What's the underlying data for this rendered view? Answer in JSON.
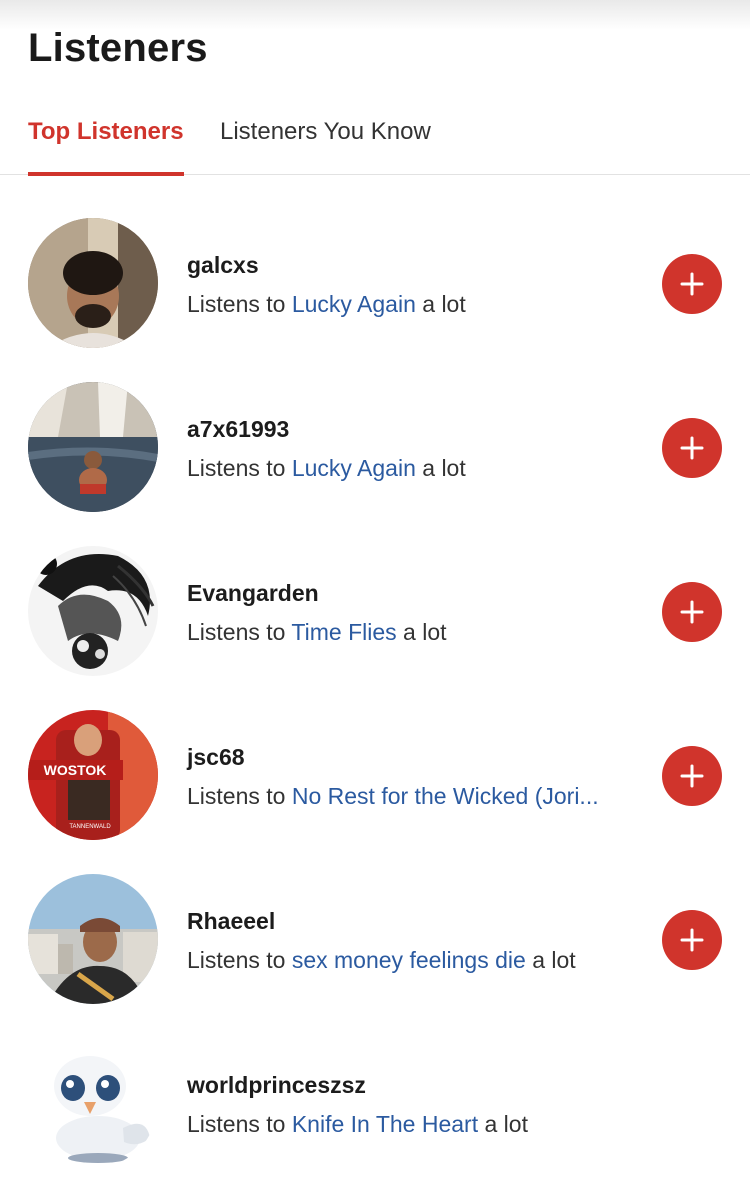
{
  "header": {
    "title": "Listeners"
  },
  "tabs": [
    {
      "label": "Top Listeners",
      "active": true
    },
    {
      "label": "Listeners You Know",
      "active": false
    }
  ],
  "listeners": [
    {
      "username": "galcxs",
      "prefix": "Listens to ",
      "song": "Lucky Again",
      "suffix": " a lot",
      "avatar": "man-with-curly-hair-photo",
      "follow": true
    },
    {
      "username": "a7x61993",
      "prefix": "Listens to ",
      "song": "Lucky Again",
      "suffix": " a lot",
      "avatar": "man-swimming-by-waterfall-photo",
      "follow": true
    },
    {
      "username": "Evangarden",
      "prefix": "Listens to ",
      "song": "Time Flies",
      "suffix": " a lot",
      "avatar": "black-and-white-artwork-photo",
      "follow": true
    },
    {
      "username": "jsc68",
      "prefix": "Listens to ",
      "song": "No Rest for the Wicked (Jori...",
      "suffix": "",
      "avatar": "wostok-bottle-photo",
      "follow": true
    },
    {
      "username": "Rhaeeel",
      "prefix": "Listens to ",
      "song": "sex money feelings die",
      "suffix": " a lot",
      "avatar": "man-in-cap-city-photo",
      "follow": true
    },
    {
      "username": "worldprinceszsz",
      "prefix": "Listens to ",
      "song": "Knife In The Heart",
      "suffix": " a lot",
      "avatar": "white-swan-toy-photo",
      "follow": false
    }
  ],
  "avatar_text": {
    "wostok": "WOSTOK",
    "tannenwald": "TANNENWALD"
  },
  "colors": {
    "accent": "#d0342c",
    "link": "#2b5aa0",
    "text": "#333333"
  }
}
